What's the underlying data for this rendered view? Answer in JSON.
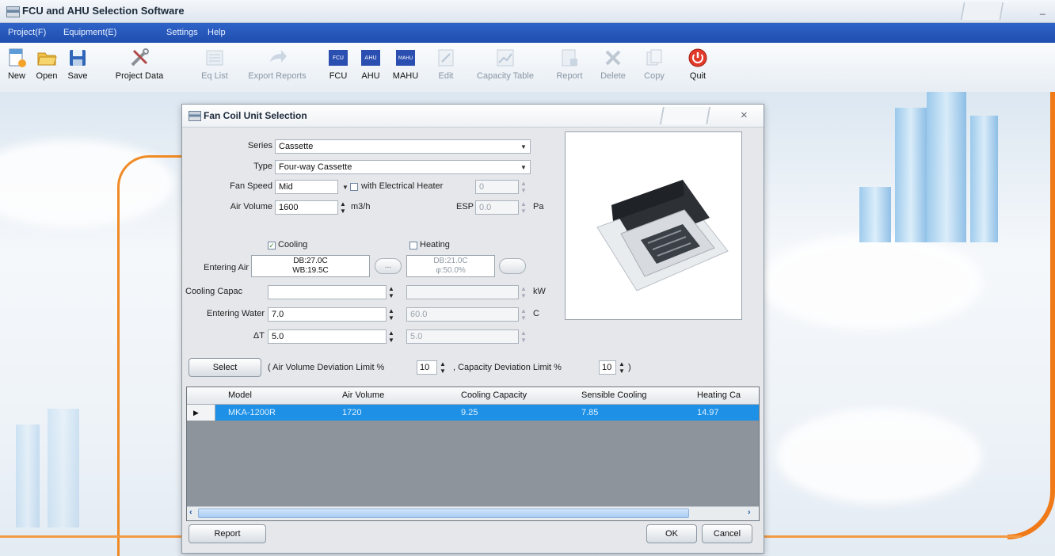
{
  "window": {
    "title": "FCU and AHU Selection Software",
    "minimize_glyph": "_"
  },
  "menu": [
    "Project(F)",
    "Equipment(E)",
    "Settings",
    "Help"
  ],
  "toolbar": {
    "new": "New",
    "open": "Open",
    "save": "Save",
    "project_data": "Project Data",
    "eq_list": "Eq List",
    "export_reports": "Export Reports",
    "fcu": "FCU",
    "ahu": "AHU",
    "mahu": "MAHU",
    "edit": "Edit",
    "capacity_table": "Capacity Table",
    "report": "Report",
    "delete": "Delete",
    "copy": "Copy",
    "quit": "Quit",
    "fcu_badge": "FCU",
    "ahu_badge": "AHU",
    "mahu_badge": "MAHU"
  },
  "dialog": {
    "title": "Fan Coil Unit Selection",
    "close_glyph": "×",
    "series": {
      "label": "Series",
      "value": "Cassette"
    },
    "type": {
      "label": "Type",
      "value": "Four-way Cassette"
    },
    "fan_speed": {
      "label": "Fan Speed",
      "value": "Mid"
    },
    "electrical_heater": {
      "label": "with Electrical Heater",
      "value": "0",
      "checked": false
    },
    "air_volume": {
      "label": "Air Volume",
      "value": "1600",
      "unit": "m3/h"
    },
    "esp": {
      "label": "ESP",
      "value": "0.0",
      "unit": "Pa"
    },
    "cooling": {
      "label": "Cooling",
      "checked": true
    },
    "heating": {
      "label": "Heating",
      "checked": false
    },
    "entering_air": {
      "label": "Entering Air",
      "cooling_line1": "DB:27.0C",
      "cooling_line2": "WB:19.5C",
      "heating_line1": "DB:21.0C",
      "heating_line2": "φ:50.0%",
      "button_glyph": "..."
    },
    "cooling_capac": {
      "label": "Cooling Capac",
      "value": "",
      "heat_value": "",
      "unit": "kW"
    },
    "entering_water": {
      "label": "Entering Water",
      "value": "7.0",
      "heat_value": "60.0",
      "unit": "C"
    },
    "delta_t": {
      "label": "ΔT",
      "value": "5.0",
      "heat_value": "5.0"
    },
    "select_button": "Select",
    "air_volume_dev": {
      "prefix": "( Air Volume Deviation Limit %",
      "value": "10"
    },
    "capacity_dev": {
      "prefix": ", Capacity Deviation Limit %",
      "value": "10",
      "suffix": ")"
    },
    "grid": {
      "columns": [
        "Model",
        "Air Volume",
        "Cooling Capacity",
        "Sensible Cooling",
        "Heating Ca"
      ],
      "rows": [
        {
          "marker": "▶",
          "model": "MKA-1200R",
          "air_volume": "1720",
          "cooling_capacity": "9.25",
          "sensible_cooling": "7.85",
          "heating_capacity": "14.97"
        }
      ]
    },
    "report_button": "Report",
    "ok_button": "OK",
    "cancel_button": "Cancel"
  },
  "colors": {
    "menubar": "#2a5fc2",
    "accent_orange": "#f08a24",
    "selection_blue": "#1e90e6"
  },
  "icons": [
    "new-icon",
    "open-icon",
    "save-icon",
    "project-data-icon",
    "eq-list-icon",
    "export-reports-icon",
    "fcu-icon",
    "ahu-icon",
    "mahu-icon",
    "edit-icon",
    "capacity-table-icon",
    "report-icon",
    "delete-icon",
    "copy-icon",
    "quit-icon"
  ]
}
